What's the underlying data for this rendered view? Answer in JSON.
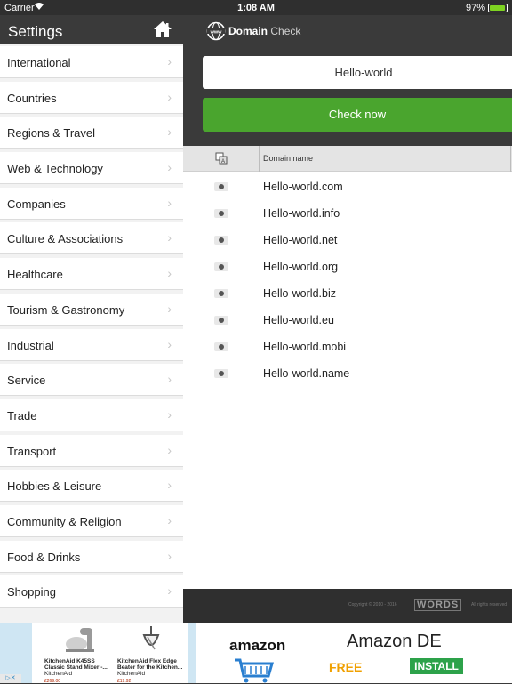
{
  "status": {
    "carrier": "Carrier",
    "time": "1:08 AM",
    "battery": "97%"
  },
  "sidebar": {
    "title": "Settings",
    "items": [
      {
        "label": "International"
      },
      {
        "label": "Countries"
      },
      {
        "label": "Regions & Travel"
      },
      {
        "label": "Web & Technology"
      },
      {
        "label": "Companies"
      },
      {
        "label": "Culture & Associations"
      },
      {
        "label": "Healthcare"
      },
      {
        "label": "Tourism & Gastronomy"
      },
      {
        "label": "Industrial"
      },
      {
        "label": "Service"
      },
      {
        "label": "Trade"
      },
      {
        "label": "Transport"
      },
      {
        "label": "Hobbies & Leisure"
      },
      {
        "label": "Community & Religion"
      },
      {
        "label": "Food & Drinks"
      },
      {
        "label": "Shopping"
      }
    ]
  },
  "app": {
    "brand_bold": "Domain",
    "brand_light": "Check",
    "search_value": "Hello-world",
    "check_button": "Check now",
    "column_header": "Domain name",
    "results": [
      "Hello-world.com",
      "Hello-world.info",
      "Hello-world.net",
      "Hello-world.org",
      "Hello-world.biz",
      "Hello-world.eu",
      "Hello-world.mobi",
      "Hello-world.name"
    ],
    "footer_copyright": "Copyright © 2010 - 2016",
    "footer_logo": "WORDS",
    "footer_rights": "All rights reserved"
  },
  "ad": {
    "products": [
      {
        "name": "KitchenAid K45SS Classic Stand Mixer -...",
        "seller": "KitchenAid",
        "price": "£269.00"
      },
      {
        "name": "KitchenAid Flex Edge Beater for the Kitchen...",
        "seller": "KitchenAid",
        "price": "£19.92"
      }
    ],
    "logo": "amazon",
    "title": "Amazon DE",
    "free": "FREE",
    "install": "INSTALL"
  }
}
